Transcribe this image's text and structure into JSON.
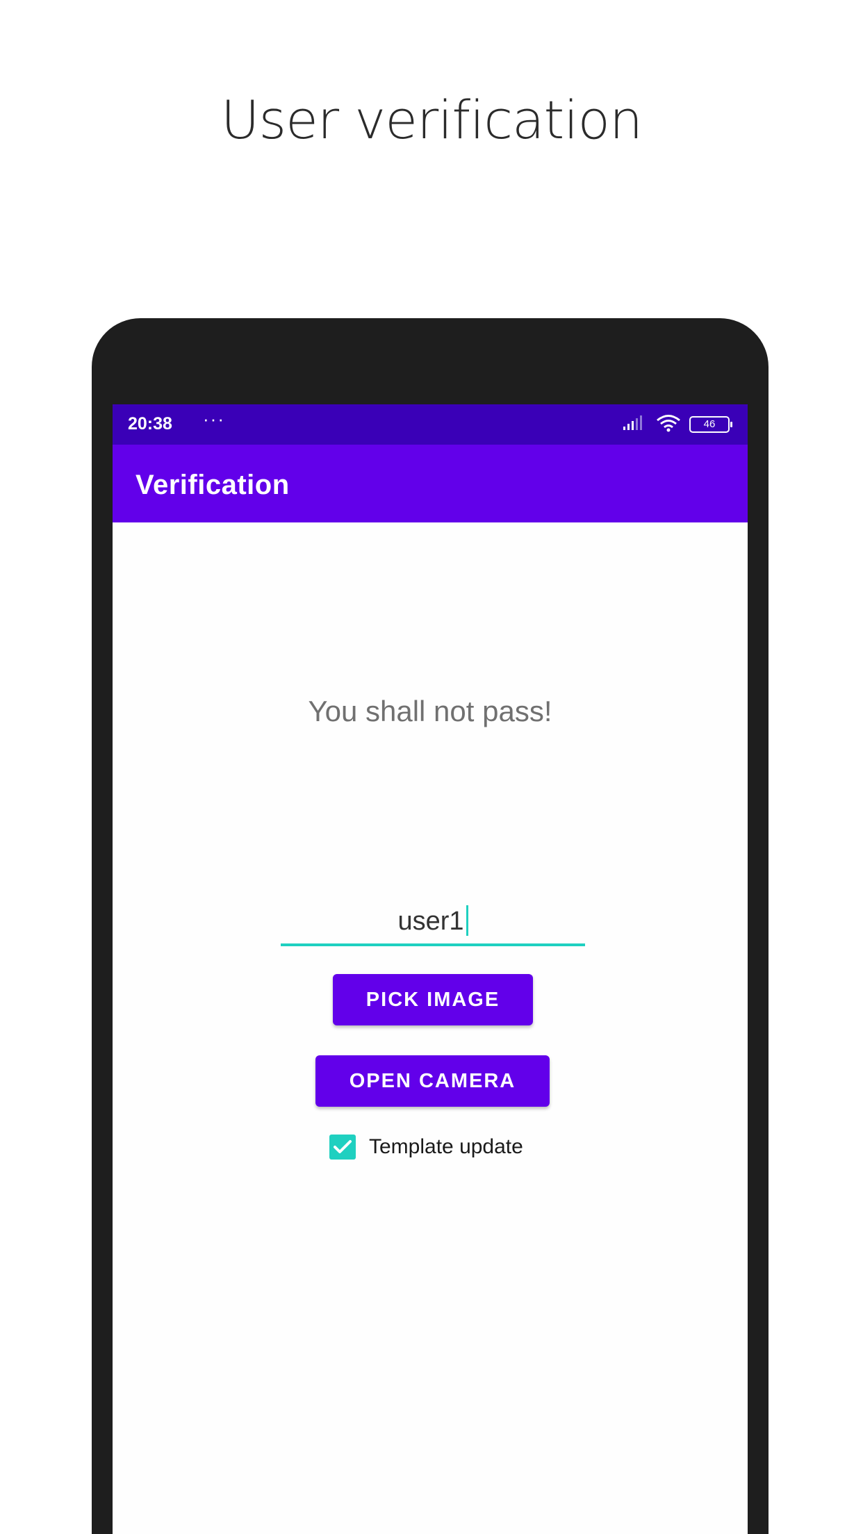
{
  "page": {
    "title": "User verification"
  },
  "status_bar": {
    "time": "20:38",
    "dots": "···",
    "battery": "46"
  },
  "app_bar": {
    "title": "Verification"
  },
  "main": {
    "message": "You shall not pass!",
    "user_field": {
      "value": "user1"
    },
    "pick_image_label": "PICK IMAGE",
    "open_camera_label": "OPEN CAMERA",
    "template_update": {
      "label": "Template update",
      "checked": true
    }
  },
  "colors": {
    "status_bar": "#3a00b7",
    "app_bar": "#6200ea",
    "accent": "#1fd0c0",
    "phone_frame": "#1e1e1e"
  },
  "icons": [
    "signal-icon",
    "wifi-icon",
    "battery-icon",
    "check-icon"
  ]
}
